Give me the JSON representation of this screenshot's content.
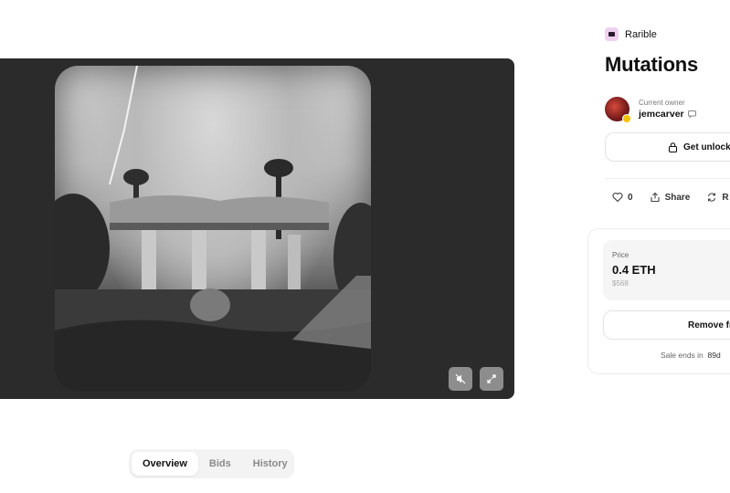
{
  "media": {
    "mute_icon": "mute-icon",
    "expand_icon": "expand-icon"
  },
  "tabs": [
    {
      "label": "Overview",
      "active": true
    },
    {
      "label": "Bids",
      "active": false
    },
    {
      "label": "History",
      "active": false
    }
  ],
  "panel": {
    "brand": "Rarible",
    "title": "Mutations",
    "owner_label": "Current owner",
    "owner_name": "jemcarver",
    "unlock_label": "Get unlock",
    "likes": "0",
    "share": "Share",
    "refresh_partial": "R",
    "price_label": "Price",
    "price_value": "0.4 ETH",
    "price_usd": "$568",
    "remove_label": "Remove fr",
    "sale_prefix": "Sale ends in",
    "sale_value": "89d"
  },
  "colors": {
    "brand_bg": "#eed1f0",
    "badge": "#f3c200",
    "media_bg": "#2b2b2b"
  }
}
